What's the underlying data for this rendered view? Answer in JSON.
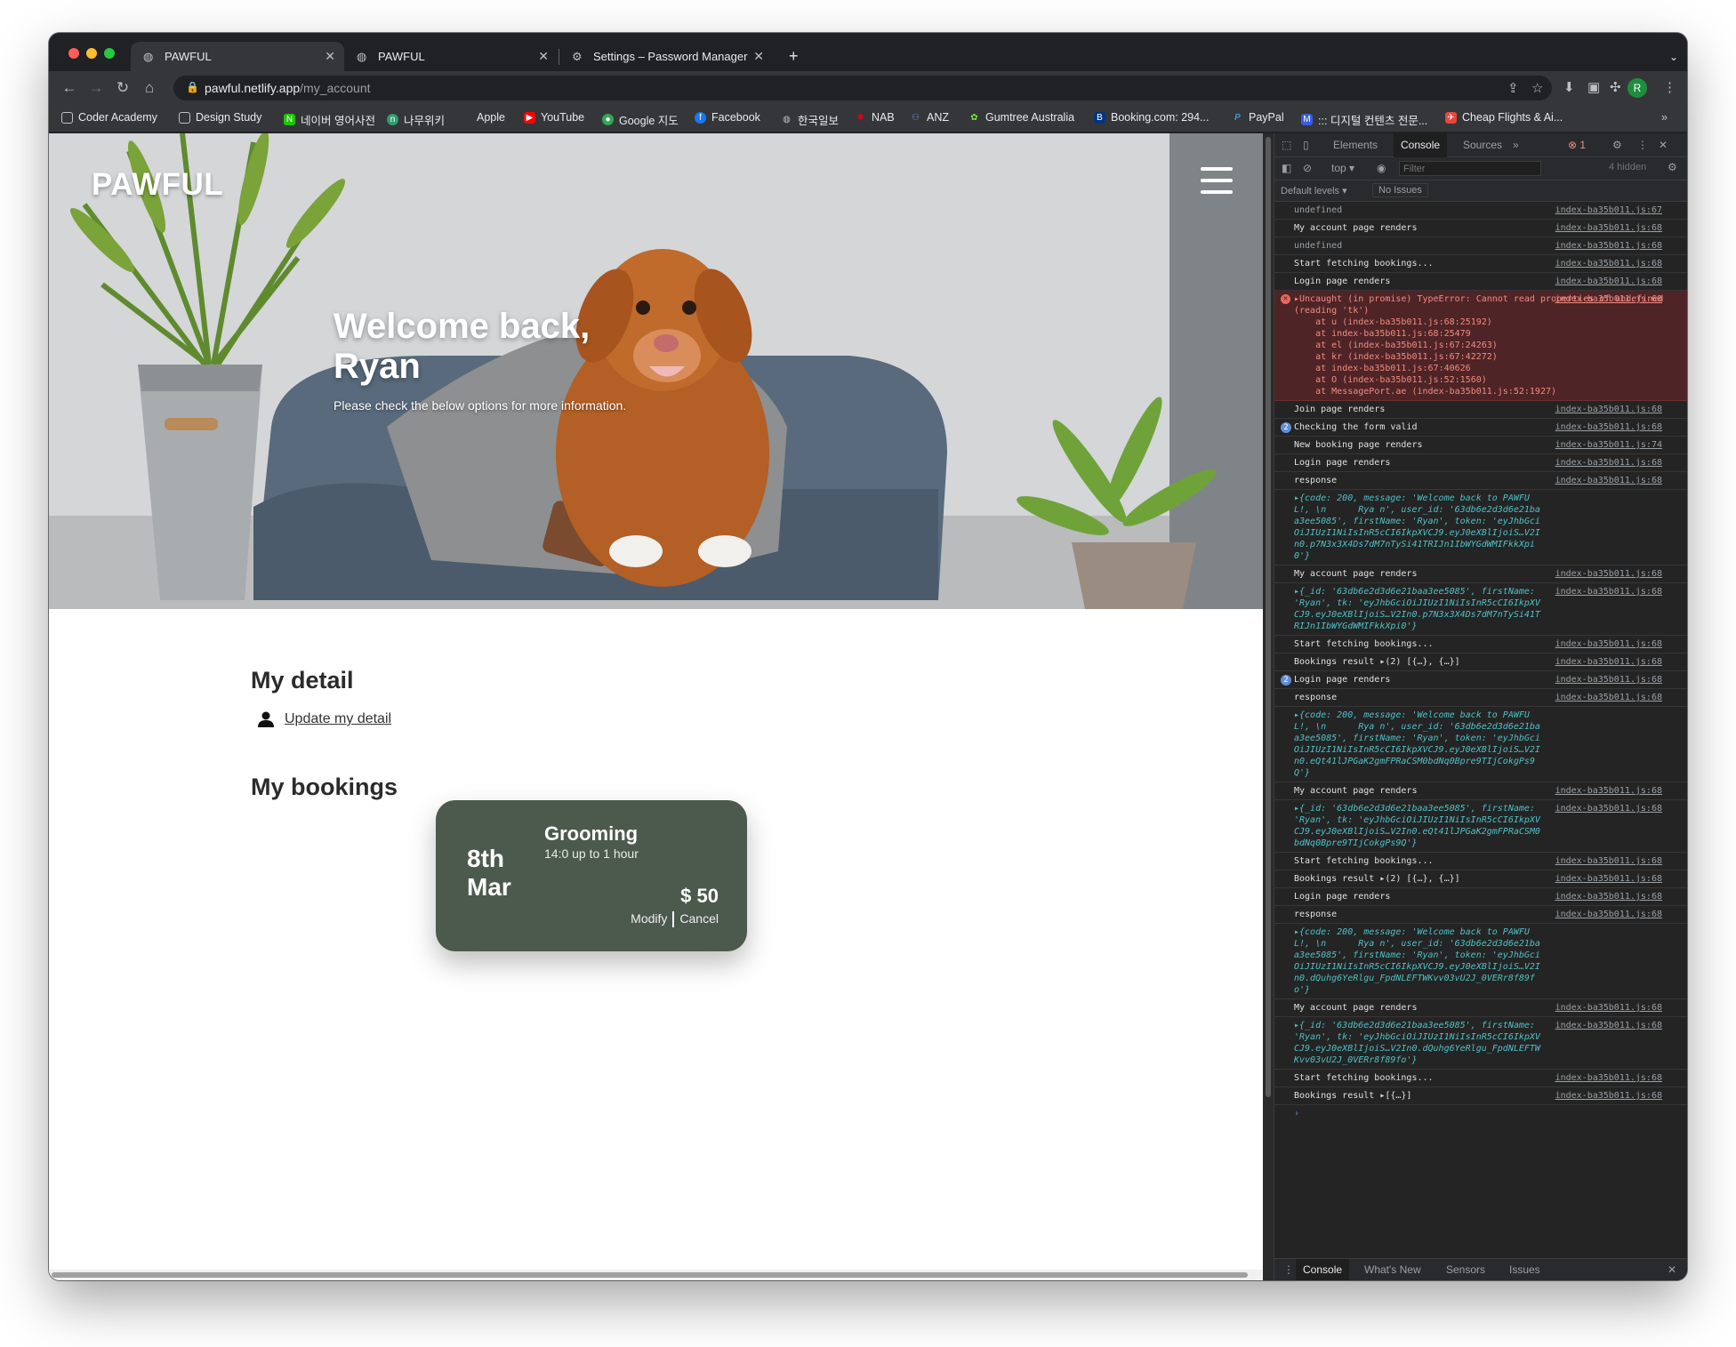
{
  "tabs": [
    {
      "title": "PAWFUL",
      "active": true
    },
    {
      "title": "PAWFUL",
      "active": false
    },
    {
      "title": "Settings – Password Manager",
      "active": false
    }
  ],
  "new_tab_label": "+",
  "address": {
    "host": "pawful.netlify.app",
    "path": "/my_account"
  },
  "avatar_letter": "R",
  "bookmarks": [
    "Coder Academy",
    "Design Study",
    "네이버 영어사전",
    "나무위키",
    "Apple",
    "YouTube",
    "Google 지도",
    "Facebook",
    "한국일보",
    "NAB",
    "ANZ",
    "Gumtree Australia",
    "Booking.com: 294...",
    "PayPal",
    "::: 디지털 컨텐츠 전문...",
    "Cheap Flights & Ai..."
  ],
  "page": {
    "brand": "PAWFUL",
    "welcome": "Welcome back, Ryan",
    "subtitle": "Please check the below options for more information.",
    "detail_title": "My detail",
    "update_link": "Update my detail",
    "bookings_title": "My bookings",
    "booking": {
      "day": "8th",
      "month": "Mar",
      "service": "Grooming",
      "time": "14:0 up to 1 hour",
      "price": "$ 50",
      "modify": "Modify",
      "cancel": "Cancel"
    }
  },
  "devtools": {
    "tabs": [
      "Elements",
      "Console",
      "Sources"
    ],
    "active_tab": "Console",
    "more": "»",
    "error_count": "1",
    "context": "top",
    "filter_placeholder": "Filter",
    "hidden": "4 hidden",
    "levels": "Default levels",
    "issues": "No Issues",
    "drawer_tabs": [
      "Console",
      "What's New",
      "Sensors",
      "Issues"
    ],
    "rows": [
      {
        "msg": "undefined",
        "src": "index-ba35b011.js:67",
        "kind": "dim"
      },
      {
        "msg": "My account page renders",
        "src": "index-ba35b011.js:68"
      },
      {
        "msg": "undefined",
        "src": "index-ba35b011.js:68",
        "kind": "dim"
      },
      {
        "msg": "Start fetching bookings...",
        "src": "index-ba35b011.js:68"
      },
      {
        "msg": "Login page renders",
        "src": "index-ba35b011.js:68"
      },
      {
        "msg": "▸Uncaught (in promise) TypeError: Cannot read properties of undefined (reading 'tk')\n    at u (index-ba35b011.js:68:25192)\n    at index-ba35b011.js:68:25479\n    at el (index-ba35b011.js:67:24263)\n    at kr (index-ba35b011.js:67:42272)\n    at index-ba35b011.js:67:40626\n    at O (index-ba35b011.js:52:1560)\n    at MessagePort.ae (index-ba35b011.js:52:1927)",
        "src": "index-ba35b011.js:68",
        "kind": "error"
      },
      {
        "msg": "Join page renders",
        "src": "index-ba35b011.js:68"
      },
      {
        "msg": "Checking the form valid",
        "src": "index-ba35b011.js:68",
        "badge": "2"
      },
      {
        "msg": "New booking page renders",
        "src": "index-ba35b011.js:74"
      },
      {
        "msg": "Login page renders",
        "src": "index-ba35b011.js:68"
      },
      {
        "msg": "response",
        "src": "index-ba35b011.js:68"
      },
      {
        "msg": "▸{code: 200, message: 'Welcome back to PAWFUL!, \\n      Rya n', user_id: '63db6e2d3d6e21baa3ee5085', firstName: 'Ryan', token: 'eyJhbGciOiJIUzI1NiIsInR5cCI6IkpXVCJ9.eyJ0eXBlIjoiS…V2In0.p7N3x3X4Ds7dM7nTySi41TRIJn1IbWYGdWMIFkkXpi0'}",
        "src": "",
        "kind": "obj"
      },
      {
        "msg": "My account page renders",
        "src": "index-ba35b011.js:68"
      },
      {
        "msg": "▸{_id: '63db6e2d3d6e21baa3ee5085', firstName: 'Ryan', tk: 'eyJhbGciOiJIUzI1NiIsInR5cCI6IkpXVCJ9.eyJ0eXBlIjoiS…V2In0.p7N3x3X4Ds7dM7nTySi41TRIJn1IbWYGdWMIFkkXpi0'}",
        "src": "index-ba35b011.js:68",
        "kind": "obj"
      },
      {
        "msg": "Start fetching bookings...",
        "src": "index-ba35b011.js:68"
      },
      {
        "msg": "Bookings result ▸(2) [{…}, {…}]",
        "src": "index-ba35b011.js:68"
      },
      {
        "msg": "Login page renders",
        "src": "index-ba35b011.js:68",
        "badge": "2"
      },
      {
        "msg": "response",
        "src": "index-ba35b011.js:68"
      },
      {
        "msg": "▸{code: 200, message: 'Welcome back to PAWFUL!, \\n      Rya n', user_id: '63db6e2d3d6e21baa3ee5085', firstName: 'Ryan', token: 'eyJhbGciOiJIUzI1NiIsInR5cCI6IkpXVCJ9.eyJ0eXBlIjoiS…V2In0.eQt41lJPGaK2gmFPRaCSM0bdNq0Bpre9TIjCokgPs9Q'}",
        "src": "",
        "kind": "obj"
      },
      {
        "msg": "My account page renders",
        "src": "index-ba35b011.js:68"
      },
      {
        "msg": "▸{_id: '63db6e2d3d6e21baa3ee5085', firstName: 'Ryan', tk: 'eyJhbGciOiJIUzI1NiIsInR5cCI6IkpXVCJ9.eyJ0eXBlIjoiS…V2In0.eQt41lJPGaK2gmFPRaCSM0bdNq0Bpre9TIjCokgPs9Q'}",
        "src": "index-ba35b011.js:68",
        "kind": "obj"
      },
      {
        "msg": "Start fetching bookings...",
        "src": "index-ba35b011.js:68"
      },
      {
        "msg": "Bookings result ▸(2) [{…}, {…}]",
        "src": "index-ba35b011.js:68"
      },
      {
        "msg": "Login page renders",
        "src": "index-ba35b011.js:68"
      },
      {
        "msg": "response",
        "src": "index-ba35b011.js:68"
      },
      {
        "msg": "▸{code: 200, message: 'Welcome back to PAWFUL!, \\n      Rya n', user_id: '63db6e2d3d6e21baa3ee5085', firstName: 'Ryan', token: 'eyJhbGciOiJIUzI1NiIsInR5cCI6IkpXVCJ9.eyJ0eXBlIjoiS…V2In0.dQuhg6YeRlgu_FpdNLEFTWKvv03vU2J_0VERr8f89fo'}",
        "src": "",
        "kind": "obj"
      },
      {
        "msg": "My account page renders",
        "src": "index-ba35b011.js:68"
      },
      {
        "msg": "▸{_id: '63db6e2d3d6e21baa3ee5085', firstName: 'Ryan', tk: 'eyJhbGciOiJIUzI1NiIsInR5cCI6IkpXVCJ9.eyJ0eXBlIjoiS…V2In0.dQuhg6YeRlgu_FpdNLEFTWKvv03vU2J_0VERr8f89fo'}",
        "src": "index-ba35b011.js:68",
        "kind": "obj"
      },
      {
        "msg": "Start fetching bookings...",
        "src": "index-ba35b011.js:68"
      },
      {
        "msg": "Bookings result ▸[{…}]",
        "src": "index-ba35b011.js:68"
      }
    ]
  }
}
